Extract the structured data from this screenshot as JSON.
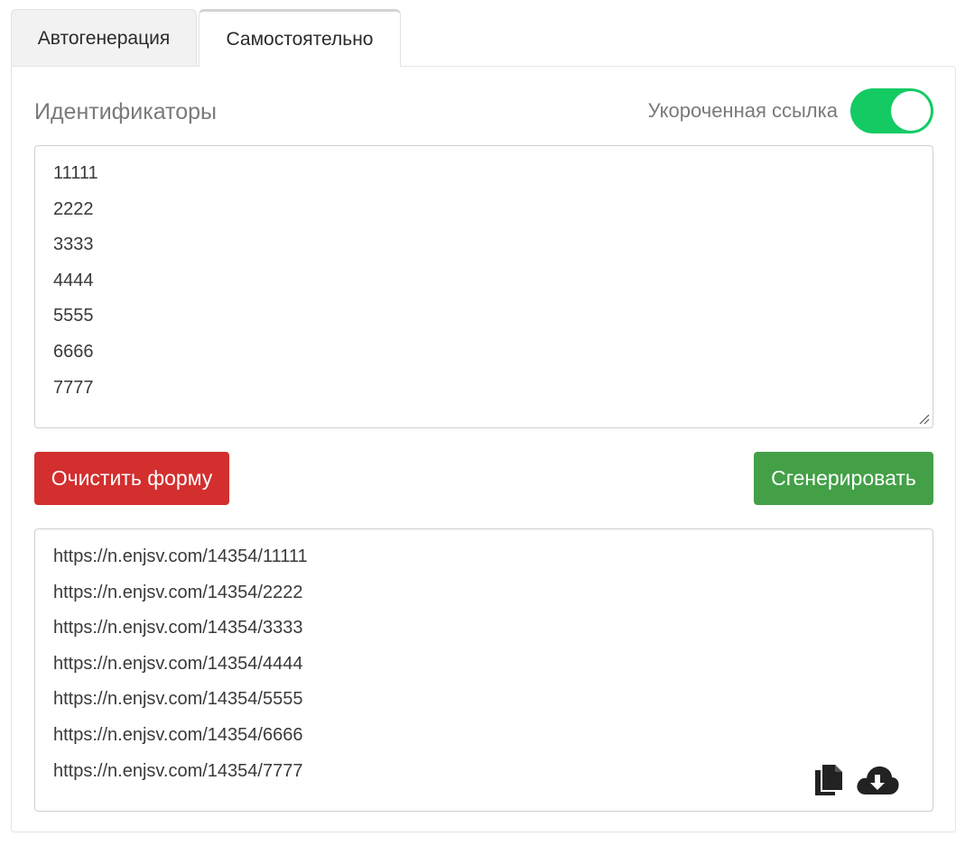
{
  "tabs": [
    {
      "label": "Автогенерация",
      "active": false
    },
    {
      "label": "Самостоятельно",
      "active": true
    }
  ],
  "section_title": "Идентификаторы",
  "short_link": {
    "label": "Укороченная ссылка",
    "enabled": true,
    "color": "#14cb63"
  },
  "ids": [
    "11111",
    "2222",
    "3333",
    "4444",
    "5555",
    "6666",
    "7777"
  ],
  "buttons": {
    "clear_label": "Очистить форму",
    "clear_color": "#d32f2f",
    "generate_label": "Сгенерировать",
    "generate_color": "#43a047"
  },
  "links": [
    "https://n.enjsv.com/14354/11111",
    "https://n.enjsv.com/14354/2222",
    "https://n.enjsv.com/14354/3333",
    "https://n.enjsv.com/14354/4444",
    "https://n.enjsv.com/14354/5555",
    "https://n.enjsv.com/14354/6666",
    "https://n.enjsv.com/14354/7777"
  ],
  "icons": {
    "copy": "copy-icon",
    "download": "cloud-download-icon"
  }
}
